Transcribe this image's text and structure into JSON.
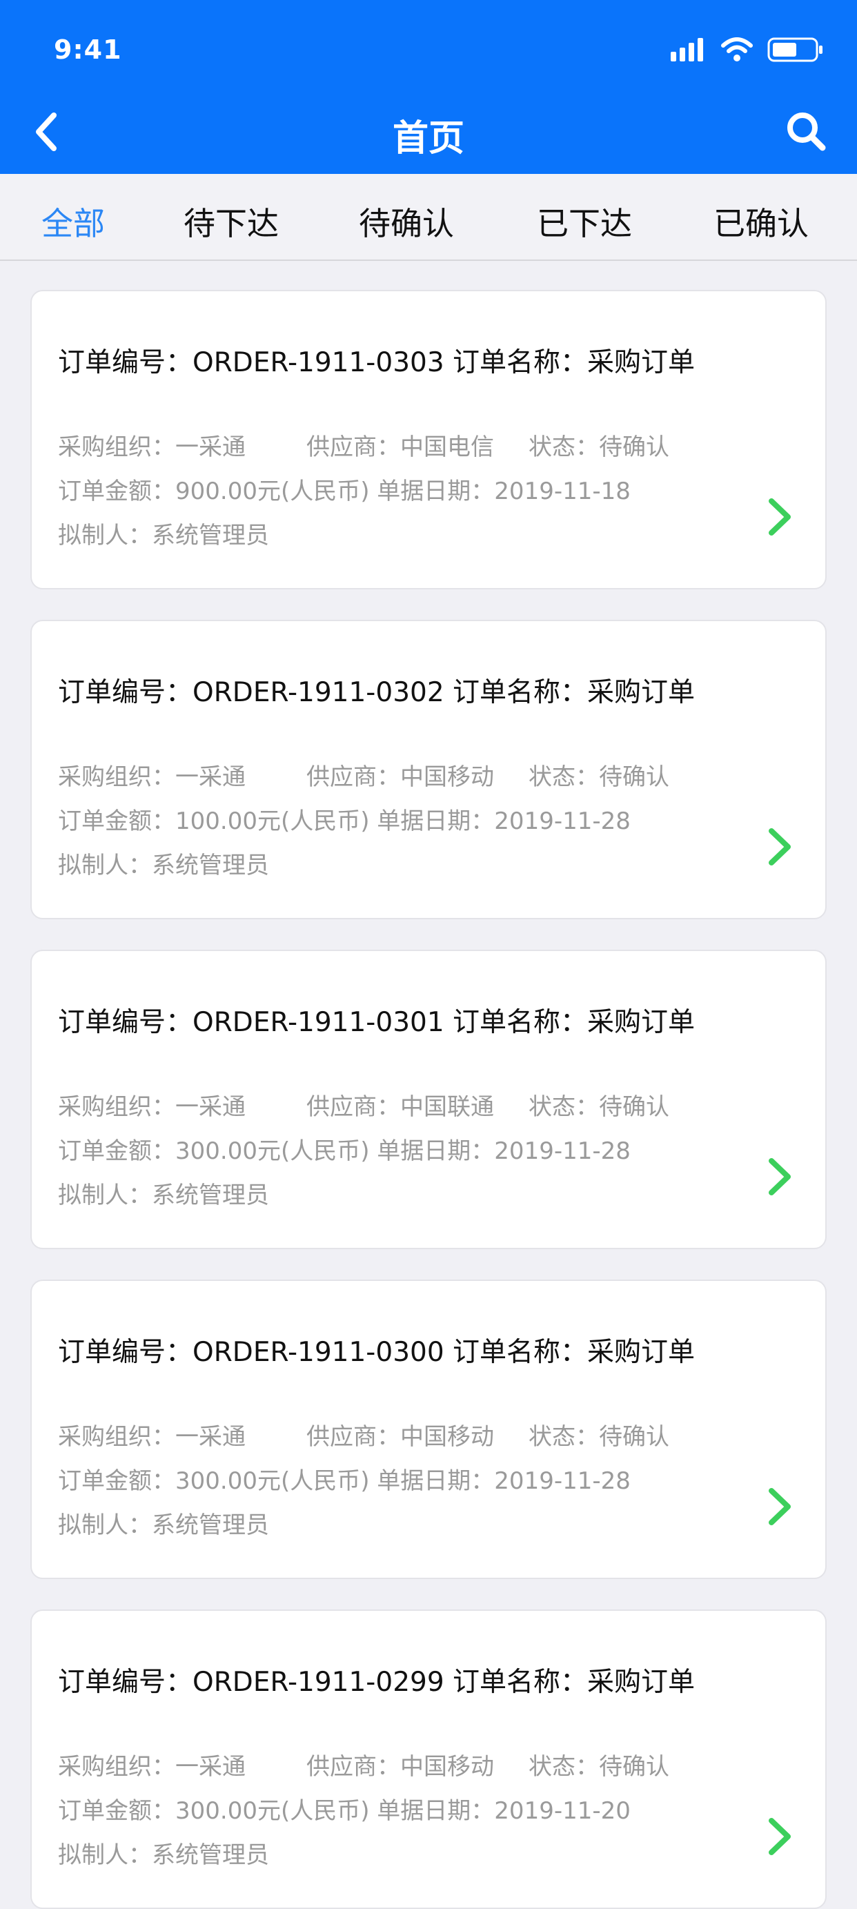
{
  "status_bar": {
    "time": "9:41"
  },
  "nav": {
    "title": "首页"
  },
  "tabs": [
    {
      "label": "全部",
      "active": true
    },
    {
      "label": "待下达",
      "active": false
    },
    {
      "label": "待确认",
      "active": false
    },
    {
      "label": "已下达",
      "active": false
    },
    {
      "label": "已确认",
      "active": false
    }
  ],
  "orders": [
    {
      "title": "订单编号：ORDER-1911-0303 订单名称：采购订单",
      "org": "采购组织：一采通",
      "supplier": "供应商：中国电信",
      "status": "状态：待确认",
      "amount_date": "订单金额：900.00元(人民币) 单据日期：2019-11-18",
      "creator": "拟制人：系统管理员"
    },
    {
      "title": "订单编号：ORDER-1911-0302 订单名称：采购订单",
      "org": "采购组织：一采通",
      "supplier": "供应商：中国移动",
      "status": "状态：待确认",
      "amount_date": "订单金额：100.00元(人民币) 单据日期：2019-11-28",
      "creator": "拟制人：系统管理员"
    },
    {
      "title": "订单编号：ORDER-1911-0301 订单名称：采购订单",
      "org": "采购组织：一采通",
      "supplier": "供应商：中国联通",
      "status": "状态：待确认",
      "amount_date": "订单金额：300.00元(人民币) 单据日期：2019-11-28",
      "creator": "拟制人：系统管理员"
    },
    {
      "title": "订单编号：ORDER-1911-0300 订单名称：采购订单",
      "org": "采购组织：一采通",
      "supplier": "供应商：中国移动",
      "status": "状态：待确认",
      "amount_date": "订单金额：300.00元(人民币) 单据日期：2019-11-28",
      "creator": "拟制人：系统管理员"
    },
    {
      "title": "订单编号：ORDER-1911-0299 订单名称：采购订单",
      "org": "采购组织：一采通",
      "supplier": "供应商：中国移动",
      "status": "状态：待确认",
      "amount_date": "订单金额：300.00元(人民币) 单据日期：2019-11-20",
      "creator": "拟制人：系统管理员"
    }
  ],
  "colors": {
    "header_bg": "#0a74fb",
    "active_tab": "#2b87f5",
    "chevron": "#3ccf5c",
    "meta_text": "#9a9a9a"
  },
  "icons": {
    "back": "chevron-left-icon",
    "search": "search-icon",
    "row_action": "chevron-right-icon",
    "signal": "signal-icon",
    "wifi": "wifi-icon",
    "battery": "battery-icon"
  }
}
